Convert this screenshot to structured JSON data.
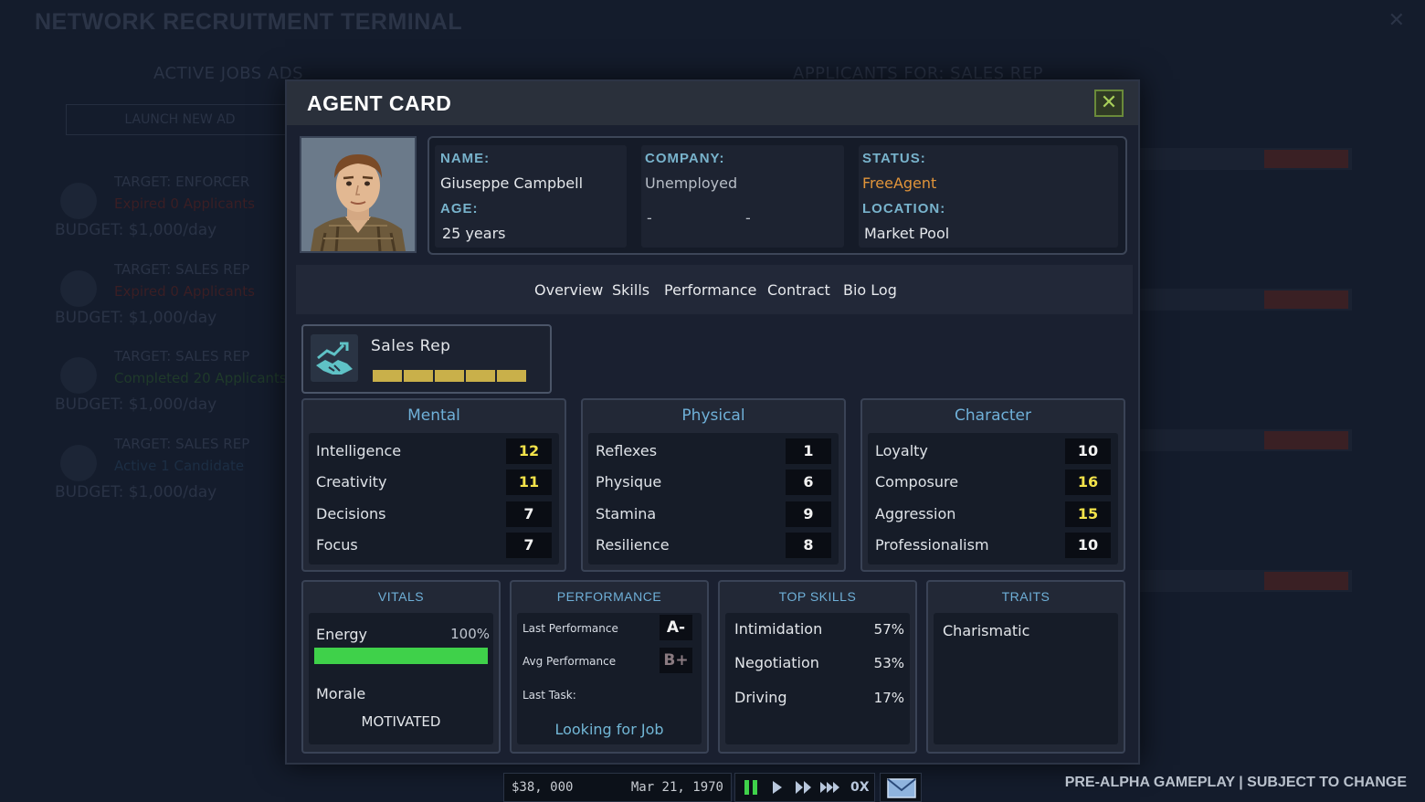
{
  "background": {
    "title": "NETWORK RECRUITMENT TERMINAL",
    "active_jobs_heading": "ACTIVE JOBS ADS",
    "launch_button": "LAUNCH NEW AD",
    "applicants_heading": "APPLICANTS FOR: SALES REP",
    "jobs": [
      {
        "target": "TARGET: ENFORCER",
        "status": "Expired 0 Applicants",
        "budget": "BUDGET: $1,000/day"
      },
      {
        "target": "TARGET: SALES REP",
        "status": "Expired 0 Applicants",
        "budget": "BUDGET: $1,000/day"
      },
      {
        "target": "TARGET: SALES REP",
        "status": "Completed 20 Applicants",
        "budget": "BUDGET: $1,000/day"
      },
      {
        "target": "TARGET: SALES REP",
        "status": "Active 1 Candidate",
        "budget": "BUDGET: $1,000/day"
      }
    ]
  },
  "modal": {
    "title": "AGENT CARD",
    "close_glyph": "✕"
  },
  "agent": {
    "name_label": "NAME:",
    "name": "Giuseppe Campbell",
    "age_label": "AGE:",
    "age": "25 years",
    "company_label": "COMPANY:",
    "company": "Unemployed",
    "company_dash_1": "-",
    "company_dash_2": "-",
    "status_label": "STATUS:",
    "status": "FreeAgent",
    "location_label": "LOCATION:",
    "location": "Market Pool"
  },
  "tabs": [
    "Overview",
    "Skills",
    "Performance",
    "Contract",
    "Bio Log"
  ],
  "role": {
    "name": "Sales Rep",
    "icon": "handshake-growth-icon",
    "level_segments": 5
  },
  "attributes": {
    "mental": {
      "title": "Mental",
      "rows": [
        {
          "name": "Intelligence",
          "value": "12",
          "highlight": true
        },
        {
          "name": "Creativity",
          "value": "11",
          "highlight": true
        },
        {
          "name": "Decisions",
          "value": "7",
          "highlight": false
        },
        {
          "name": "Focus",
          "value": "7",
          "highlight": false
        }
      ]
    },
    "physical": {
      "title": "Physical",
      "rows": [
        {
          "name": "Reflexes",
          "value": "1",
          "highlight": false
        },
        {
          "name": "Physique",
          "value": "6",
          "highlight": false
        },
        {
          "name": "Stamina",
          "value": "9",
          "highlight": false
        },
        {
          "name": "Resilience",
          "value": "8",
          "highlight": false
        }
      ]
    },
    "character": {
      "title": "Character",
      "rows": [
        {
          "name": "Loyalty",
          "value": "10",
          "highlight": false
        },
        {
          "name": "Composure",
          "value": "16",
          "highlight": true
        },
        {
          "name": "Aggression",
          "value": "15",
          "highlight": true
        },
        {
          "name": "Professionalism",
          "value": "10",
          "highlight": false
        }
      ]
    }
  },
  "vitals": {
    "title": "VITALS",
    "energy_label": "Energy",
    "energy_pct_text": "100%",
    "energy_fraction": 1.0,
    "morale_label": "Morale",
    "morale_value": "MOTIVATED"
  },
  "performance": {
    "title": "PERFORMANCE",
    "last_label": "Last Performance",
    "last_grade": "A-",
    "avg_label": "Avg Performance",
    "avg_grade": "B+",
    "task_label": "Last Task:",
    "task_value": "Looking for Job"
  },
  "top_skills": {
    "title": "TOP SKILLS",
    "items": [
      {
        "name": "Intimidation",
        "pct": "57%"
      },
      {
        "name": "Negotiation",
        "pct": "53%"
      },
      {
        "name": "Driving",
        "pct": "17%"
      }
    ]
  },
  "traits": {
    "title": "TRAITS",
    "items": [
      "Charismatic"
    ]
  },
  "hud": {
    "money": "$38, 000",
    "date": "Mar 21, 1970",
    "speed": "0X",
    "mail_icon": "envelope-icon"
  },
  "footer_notice": "PRE-ALPHA GAMEPLAY | SUBJECT TO CHANGE",
  "colors": {
    "accent_blue": "#6fb0d8",
    "stat_highlight": "#f2e24a",
    "status_orange": "#e0943a",
    "energy_green": "#3fd14a",
    "grade_a": "#f2f2f2",
    "grade_b": "#8a7a80"
  }
}
